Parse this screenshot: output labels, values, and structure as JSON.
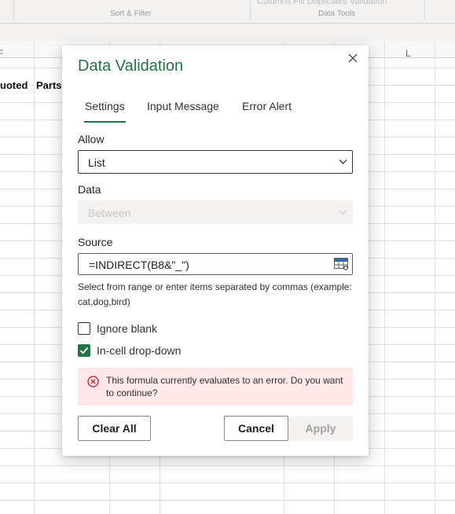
{
  "ribbon": {
    "partial_top_text": "Columns   Fill   Duplicates  Validation",
    "groups": [
      "Sort & Filter",
      "Data Tools"
    ]
  },
  "sheet": {
    "column_letters": [
      "F",
      "L"
    ],
    "header_cells": [
      "uoted",
      "Parts"
    ]
  },
  "dialog": {
    "title": "Data Validation",
    "close_icon": "close-icon",
    "tabs": [
      {
        "label": "Settings",
        "active": true
      },
      {
        "label": "Input Message",
        "active": false
      },
      {
        "label": "Error Alert",
        "active": false
      }
    ],
    "allow": {
      "label": "Allow",
      "value": "List"
    },
    "data": {
      "label": "Data",
      "value": "Between",
      "disabled": true
    },
    "source": {
      "label": "Source",
      "value": "=INDIRECT(B8&\"_\")",
      "icon": "range-select-icon"
    },
    "hint": "Select from range or enter items separated by commas (example: cat,dog,bird)",
    "ignore_blank": {
      "label": "Ignore blank",
      "checked": false
    },
    "in_cell_dropdown": {
      "label": "In-cell drop-down",
      "checked": true
    },
    "error_message": "This formula currently evaluates to an error. Do you want to continue?",
    "buttons": {
      "clear_all": "Clear All",
      "cancel": "Cancel",
      "apply": "Apply"
    },
    "colors": {
      "accent": "#217346",
      "error_bg": "#fde7e9",
      "error_icon": "#c50f1f"
    }
  }
}
